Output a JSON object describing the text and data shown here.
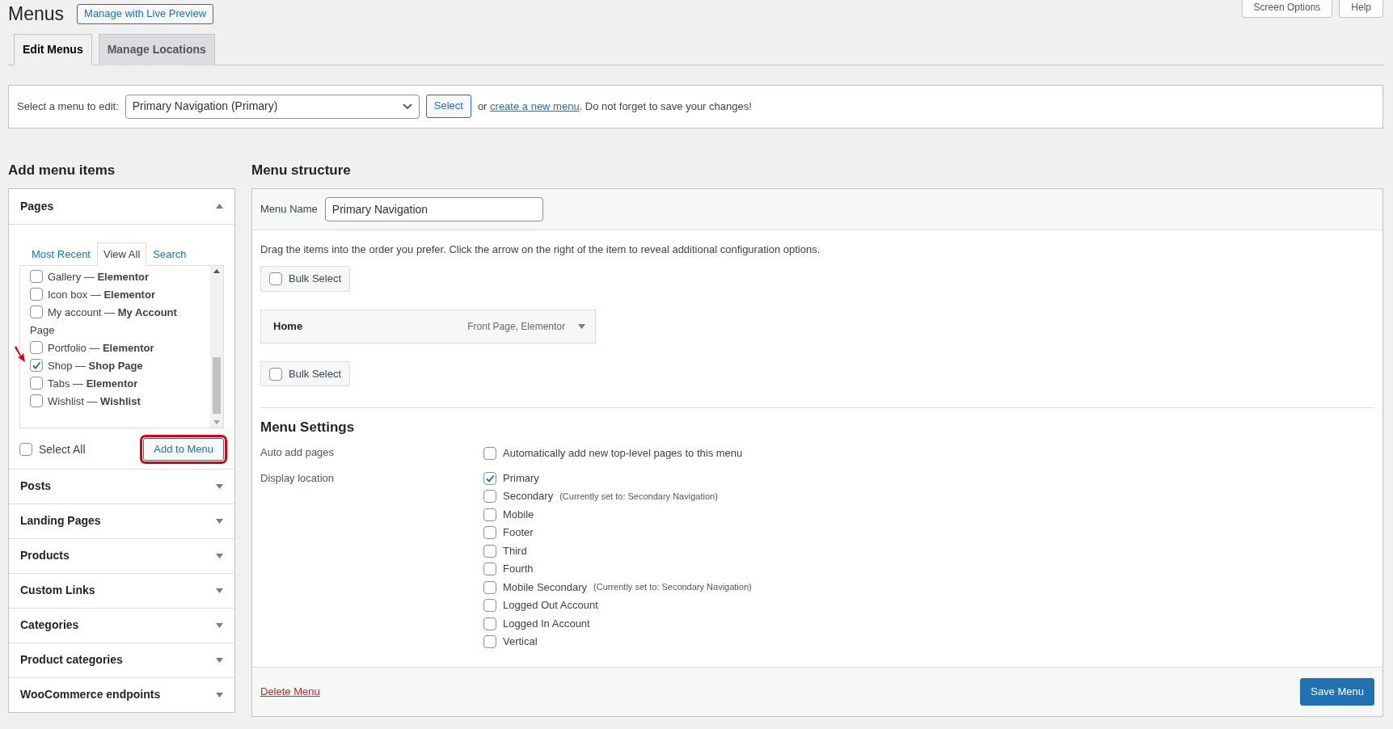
{
  "page": {
    "title": "Menus",
    "live_preview_button": "Manage with Live Preview",
    "top_buttons": [
      {
        "label": "Screen Options"
      },
      {
        "label": "Help"
      }
    ]
  },
  "tabs": [
    {
      "label": "Edit Menus",
      "selected": true
    },
    {
      "label": "Manage Locations",
      "selected": false
    }
  ],
  "select_bar": {
    "label": "Select a menu to edit:",
    "value": "Primary Navigation (Primary)",
    "button": "Select",
    "text_before": "or ",
    "link": "create a new menu",
    "text_after": ". Do not forget to save your changes!"
  },
  "add_items": {
    "heading": "Add menu items",
    "sections": [
      {
        "title": "Pages",
        "expanded": true,
        "subtabs": [
          {
            "label": "Most Recent",
            "selected": false
          },
          {
            "label": "View All",
            "selected": true
          },
          {
            "label": "Search",
            "selected": false
          }
        ],
        "list": [
          {
            "kind": "item",
            "label": "Gallery — **Elementor**",
            "checked": false
          },
          {
            "kind": "item",
            "label": "Icon box — **Elementor**",
            "checked": false
          },
          {
            "kind": "item",
            "label": "My account — **My Account**",
            "checked": false
          },
          {
            "kind": "heading",
            "label": "Page"
          },
          {
            "kind": "item",
            "label": "Portfolio — **Elementor**",
            "checked": false
          },
          {
            "kind": "item",
            "label": "Shop — **Shop Page**",
            "checked": true,
            "marked": true
          },
          {
            "kind": "item",
            "label": "Tabs — **Elementor**",
            "checked": false
          },
          {
            "kind": "item",
            "label": "Wishlist — **Wishlist**",
            "checked": false
          }
        ],
        "select_all": {
          "label": "Select All",
          "checked": false
        },
        "add_button": {
          "label": "Add to Menu",
          "highlighted": true
        }
      },
      {
        "title": "Posts",
        "expanded": false
      },
      {
        "title": "Landing Pages",
        "expanded": false
      },
      {
        "title": "Products",
        "expanded": false
      },
      {
        "title": "Custom Links",
        "expanded": false
      },
      {
        "title": "Categories",
        "expanded": false
      },
      {
        "title": "Product categories",
        "expanded": false
      },
      {
        "title": "WooCommerce endpoints",
        "expanded": false
      }
    ]
  },
  "menu_structure": {
    "heading": "Menu structure",
    "menu_name_label": "Menu Name",
    "menu_name": "Primary Navigation",
    "instructions": "Drag the items into the order you prefer. Click the arrow on the right of the item to reveal additional configuration options.",
    "bulk_select_top": {
      "label": "Bulk Select",
      "checked": false
    },
    "items": [
      {
        "title": "Home",
        "meta": "Front Page, Elementor"
      }
    ],
    "bulk_select_bottom": {
      "label": "Bulk Select",
      "checked": false
    },
    "settings": {
      "heading": "Menu Settings",
      "auto_add_label": "Auto add pages",
      "auto_add": {
        "label": "Automatically add new top-level pages to this menu",
        "checked": false
      },
      "display_location_label": "Display location",
      "locations": [
        {
          "label": "Primary",
          "checked": true
        },
        {
          "label": "Secondary",
          "note": "(Currently set to: Secondary Navigation)",
          "checked": false
        },
        {
          "label": "Mobile",
          "checked": false
        },
        {
          "label": "Footer",
          "checked": false
        },
        {
          "label": "Third",
          "checked": false
        },
        {
          "label": "Fourth",
          "checked": false
        },
        {
          "label": "Mobile Secondary",
          "note": "(Currently set to: Secondary Navigation)",
          "checked": false
        },
        {
          "label": "Logged Out Account",
          "checked": false
        },
        {
          "label": "Logged In Account",
          "checked": false
        },
        {
          "label": "Vertical",
          "checked": false
        }
      ]
    },
    "delete_link": "Delete Menu",
    "save_button": "Save Menu"
  }
}
